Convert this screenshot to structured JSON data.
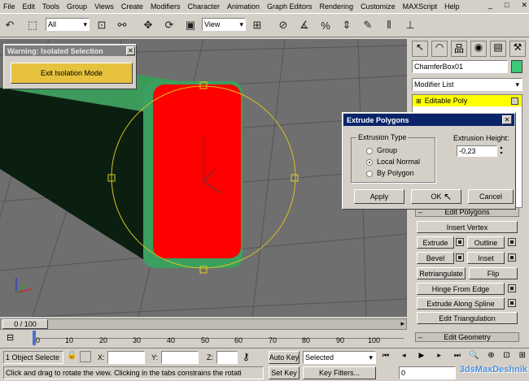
{
  "menu": [
    "File",
    "Edit",
    "Tools",
    "Group",
    "Views",
    "Create",
    "Modifiers",
    "Character",
    "Animation",
    "Graph Editors",
    "Rendering",
    "Customize",
    "MAXScript",
    "Help"
  ],
  "toolbar": {
    "selection_filter": "All",
    "ref_coord": "View"
  },
  "isolation": {
    "title": "Warning: Isolated Selection",
    "close": "✕",
    "exit_button": "Exit Isolation Mode"
  },
  "command_panel": {
    "object_name": "ChamferBox01",
    "object_color": "#3ec87a",
    "modifier_list": "Modifier List",
    "stack_item": "Editable Poly",
    "rollout_edit_polygons": "Edit Polygons",
    "rollout_edit_geometry": "Edit Geometry",
    "buttons": {
      "insert_vertex": "Insert Vertex",
      "extrude": "Extrude",
      "outline": "Outline",
      "bevel": "Bevel",
      "inset": "Inset",
      "retriangulate": "Retriangulate",
      "flip": "Flip",
      "hinge": "Hinge From Edge",
      "extrude_spline": "Extrude Along Spline",
      "edit_triangulation": "Edit Triangulation"
    }
  },
  "dialog": {
    "title": "Extrude Polygons",
    "close": "✕",
    "group_label": "Extrusion Type",
    "options": [
      "Group",
      "Local Normal",
      "By Polygon"
    ],
    "selected_option": "Local Normal",
    "height_label": "Extrusion Height:",
    "height_value": "-0,23",
    "apply": "Apply",
    "ok": "OK",
    "cancel": "Cancel"
  },
  "timeline": {
    "slider": "0 / 100",
    "ticks": [
      "0",
      "10",
      "20",
      "30",
      "40",
      "50",
      "60",
      "70",
      "80",
      "90",
      "100"
    ]
  },
  "status": {
    "selection": "1 Object Selecte",
    "x_label": "X:",
    "y_label": "Y:",
    "z_label": "Z:",
    "auto_key": "Auto Key",
    "key_mode": "Selected",
    "set_key": "Set Key",
    "key_filters": "Key Filters...",
    "frame": "0",
    "prompt": "Click and drag to rotate the view.  Clicking in the tabs constrains the rotati"
  },
  "watermark": "3dsMaxDeshnik",
  "colors": {
    "ui": "#d4d0c8",
    "title_active": "#0a246a",
    "title_inactive": "#808080",
    "selected_face": "#ff0000",
    "box": "#3c9a5a",
    "stack_highlight": "#ffff00"
  }
}
